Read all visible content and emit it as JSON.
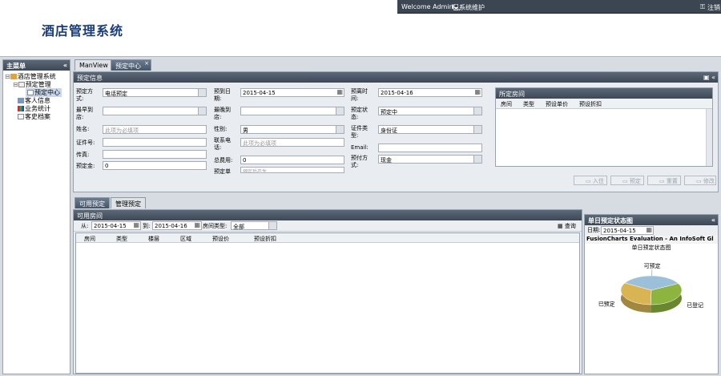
{
  "topbar": {
    "welcome": "Welcome Admin",
    "sysmaint": "系统维护",
    "logout": "注销"
  },
  "app_title": "酒店管理系统",
  "sidebar": {
    "title": "主菜单",
    "tree": [
      "酒店管理系统",
      "预定管理",
      "预定中心",
      "客人信息",
      "业务统计",
      "客史档案"
    ]
  },
  "tabs": {
    "tab1": "ManView",
    "tab2": "预定中心"
  },
  "booking": {
    "title": "预定信息",
    "labels": {
      "method": "预定方式:",
      "arrive": "预到日期:",
      "leave": "预离时间:",
      "earliest": "最早到店:",
      "latest": "最晚到店:",
      "status": "预定状态:",
      "name": "姓名:",
      "gender": "性别:",
      "idtype": "证件类型:",
      "idno": "证件号:",
      "contact": "联系电话:",
      "email": "Email:",
      "fax": "传真:",
      "total": "总费用:",
      "paymethod": "预付方式:",
      "deposit": "预定金:",
      "orderno": "预定单"
    },
    "values": {
      "method": "电话预定",
      "arrive": "2015-04-15",
      "leave": "2015-04-16",
      "status": "预定中",
      "name_ph": "此项为必填项",
      "gender": "男",
      "idtype": "身份证",
      "contact_ph": "此项为必填项",
      "total": "0",
      "paymethod": "现金",
      "deposit": "0",
      "orderno_ph": "预定后产生"
    }
  },
  "rooms_panel": {
    "title": "所定房间",
    "cols": [
      "房间",
      "类型",
      "预设单价",
      "预设折扣"
    ]
  },
  "actions": {
    "checkin": "入住",
    "book": "预定",
    "reset": "重置",
    "edit": "修改"
  },
  "bottom_tabs": {
    "available": "可用预定",
    "manage": "管理预定"
  },
  "avail": {
    "title": "可用房间",
    "from_label": "从:",
    "from": "2015-04-15",
    "to_label": "到:",
    "to": "2015-04-16",
    "type_label": "房间类型:",
    "type": "全部",
    "query": "查询",
    "cols": [
      "房间",
      "类型",
      "楼层",
      "区域",
      "预设价",
      "预设折扣"
    ]
  },
  "daily": {
    "title": "单日预定状态图",
    "date_label": "日期:",
    "date": "2015-04-15",
    "banner": "FusionCharts Evaluation - An InfoSoft Gl",
    "chart_title": "单日预定状态图"
  },
  "chart_data": {
    "type": "pie",
    "title": "单日预定状态图",
    "categories": [
      "可预定",
      "已登记",
      "已预定"
    ],
    "values": [
      34,
      33,
      33
    ],
    "colors": [
      "#9dc0da",
      "#8cb43e",
      "#d8b552"
    ]
  }
}
